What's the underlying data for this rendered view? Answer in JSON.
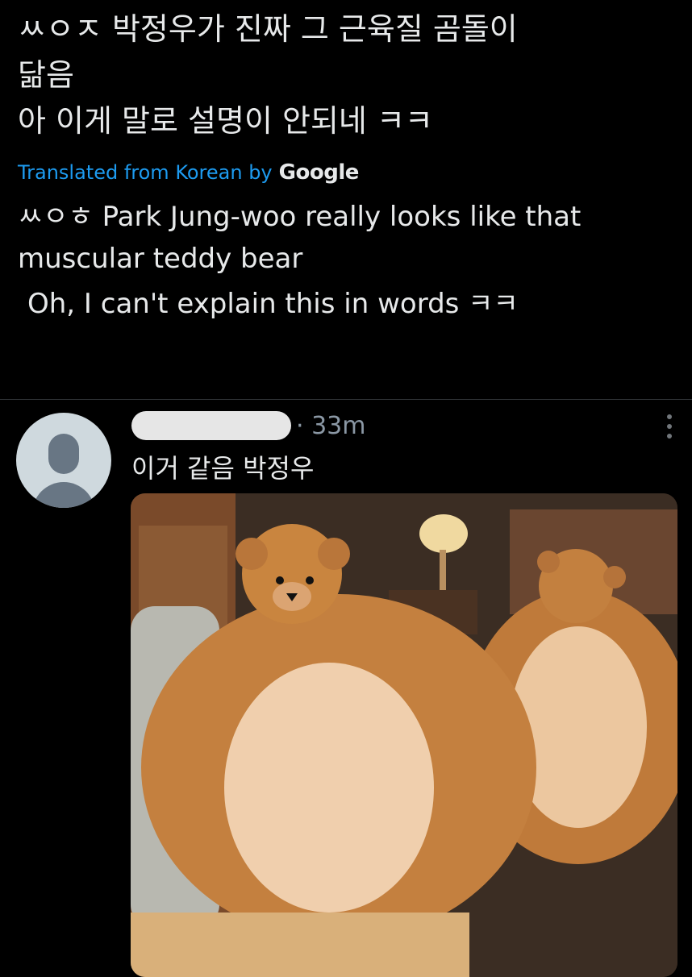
{
  "tweet": {
    "original_lines": [
      "ㅆㅇㅈ 박정우가 진짜 그 근육질 곰돌이",
      "닮음",
      "아 이게 말로 설명이 안되네 ㅋㅋ"
    ],
    "translated_label": "Translated from Korean by",
    "translator": "Google",
    "translation_lines": [
      "ㅆㅇㅎ Park Jung-woo really looks like that",
      "muscular teddy bear",
      "Oh, I can't explain this in words ㅋㅋ"
    ]
  },
  "reply": {
    "time": "· 33m",
    "text": "이거 같음 박정우",
    "icons": {
      "avatar": "default-avatar-icon",
      "more": "more-options-icon"
    }
  },
  "colors": {
    "background": "#000000",
    "link": "#1d9bf0",
    "text": "#e7e9ea",
    "muted": "#8b98a5"
  }
}
